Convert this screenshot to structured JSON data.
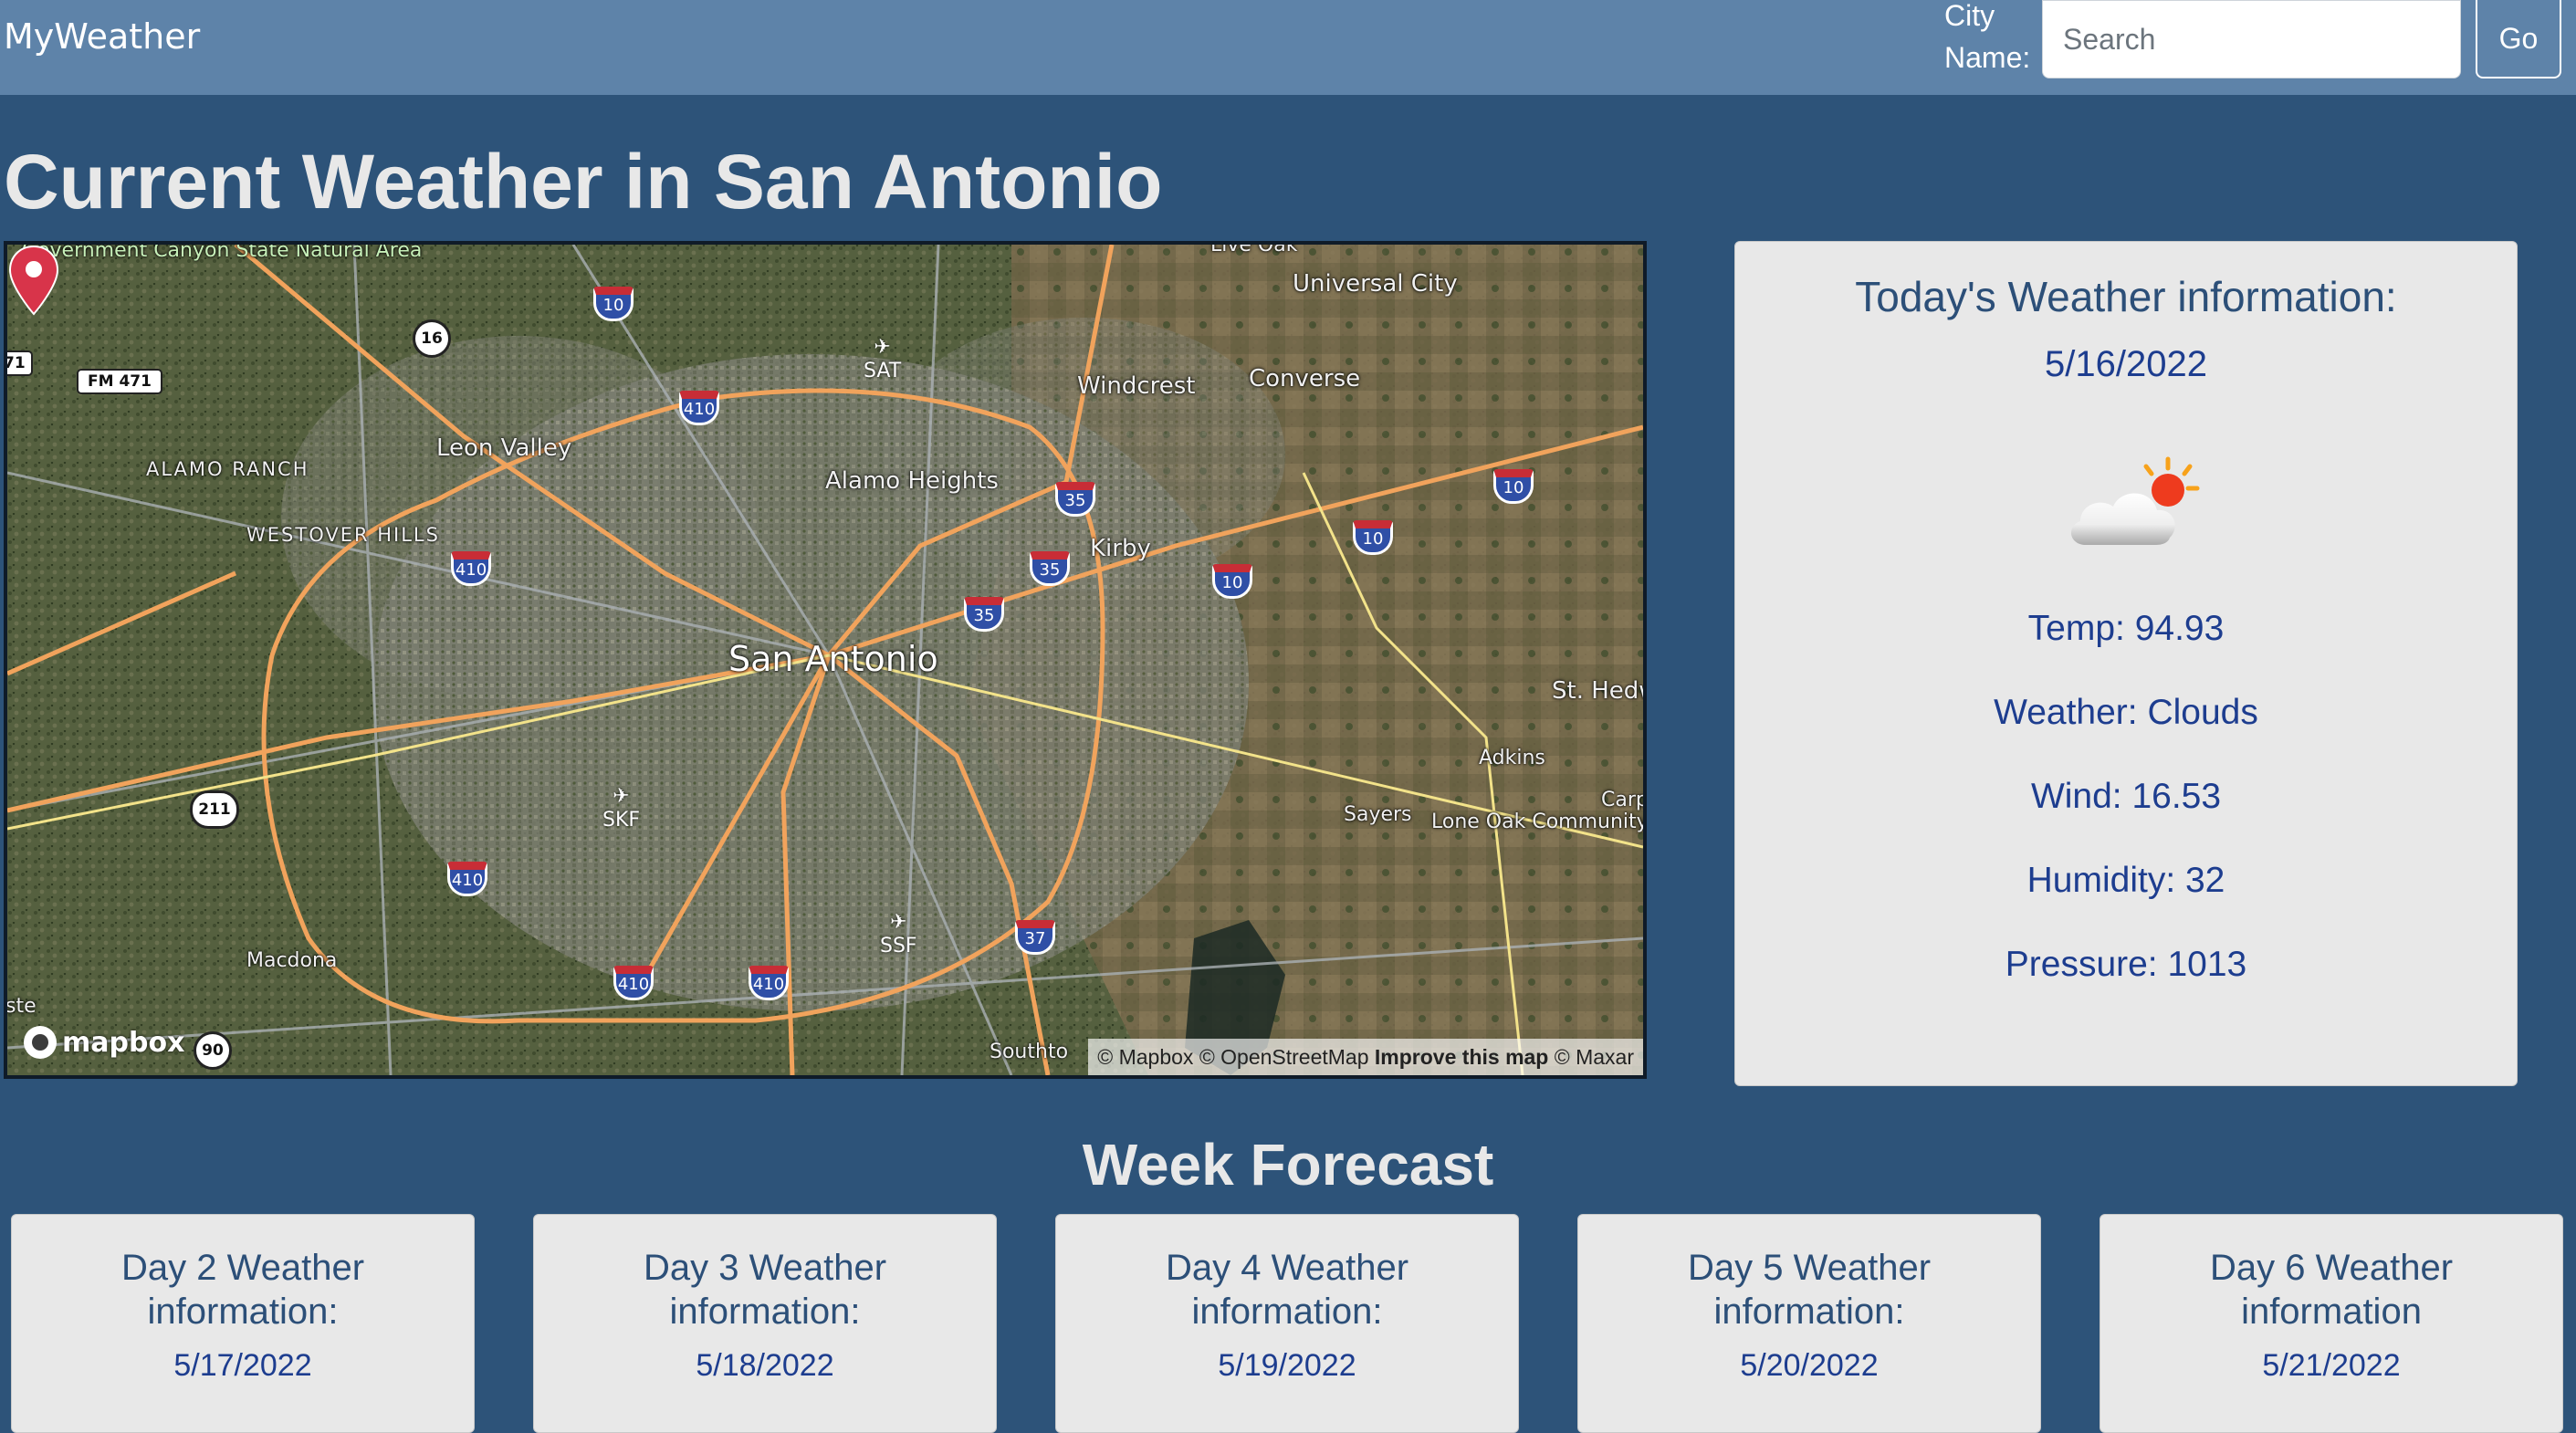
{
  "navbar": {
    "brand": "MyWeather",
    "city_label": "City Name:",
    "search_placeholder": "Search",
    "search_value": "",
    "go_label": "Go"
  },
  "page_title": "Current Weather in San Antonio",
  "map": {
    "labels": {
      "park": "Government Canyon State Natural Area",
      "universal_city": "Universal City",
      "windcrest": "Windcrest",
      "converse": "Converse",
      "leon_valley": "Leon Valley",
      "alamo_heights": "Alamo Heights",
      "alamo_ranch": "ALAMO RANCH",
      "westover_hills": "WESTOVER HILLS",
      "kirby": "Kirby",
      "san_antonio": "San Antonio",
      "st_hedwig": "St. Hedw",
      "adkins": "Adkins",
      "sayers": "Sayers",
      "lone_oak": "Lone Oak Community",
      "macdona": "Macdona",
      "live_oak": "Live Oak",
      "carp": "Carp",
      "southton": "Southto",
      "ste": "ste"
    },
    "airports": {
      "sat": "SAT",
      "skf": "SKF",
      "ssf": "SSF"
    },
    "roads": {
      "i10": "10",
      "i35": "35",
      "i37": "37",
      "i410": "410",
      "us90": "90",
      "r16": "16",
      "r211": "211",
      "fm471": "FM 471",
      "r71": "71"
    },
    "logo": "mapbox",
    "attribution": {
      "mapbox": "© Mapbox",
      "osm": "© OpenStreetMap",
      "improve": "Improve this map",
      "maxar": "© Maxar"
    }
  },
  "today": {
    "title": "Today's Weather information:",
    "date": "5/16/2022",
    "icon": "partly-cloudy-icon",
    "temp": "Temp: 94.93",
    "weather": "Weather: Clouds",
    "wind": "Wind: 16.53",
    "humidity": "Humidity: 32",
    "pressure": "Pressure: 1013"
  },
  "week": {
    "title": "Week Forecast",
    "days": [
      {
        "title": "Day 2 Weather information:",
        "date": "5/17/2022"
      },
      {
        "title": "Day 3 Weather information:",
        "date": "5/18/2022"
      },
      {
        "title": "Day 4 Weather information:",
        "date": "5/19/2022"
      },
      {
        "title": "Day 5 Weather information:",
        "date": "5/20/2022"
      },
      {
        "title": "Day 6 Weather information",
        "date": "5/21/2022"
      }
    ]
  },
  "colors": {
    "page_bg": "#2d5379",
    "navbar_bg": "#5e83a9",
    "card_bg": "#e8e8e8",
    "card_title": "#2c4f78",
    "card_text": "#1d3d8f",
    "pin": "#d8344a"
  }
}
